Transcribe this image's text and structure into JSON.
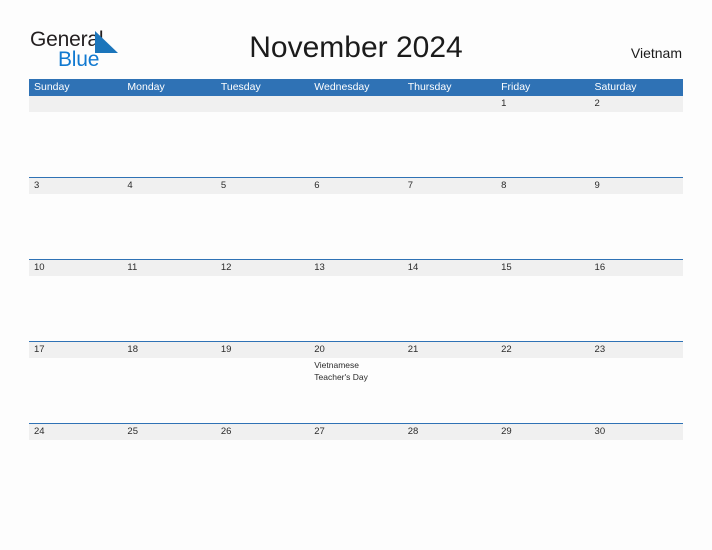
{
  "brand": {
    "name_top": "General",
    "name_bottom": "Blue",
    "flag_color": "#1b75bb",
    "blue_text_color": "#1179d0",
    "top_text_color": "#231f20"
  },
  "header": {
    "title": "November 2024",
    "country": "Vietnam"
  },
  "colors": {
    "header_blue": "#2f72b5",
    "date_band_gray": "#f0f0f0",
    "page_background": "#fdfdfd",
    "separator_blue": "#2f72b5"
  },
  "calendar": {
    "day_headers": [
      "Sunday",
      "Monday",
      "Tuesday",
      "Wednesday",
      "Thursday",
      "Friday",
      "Saturday"
    ],
    "weeks": [
      {
        "days": [
          {
            "date": "",
            "events": []
          },
          {
            "date": "",
            "events": []
          },
          {
            "date": "",
            "events": []
          },
          {
            "date": "",
            "events": []
          },
          {
            "date": "",
            "events": []
          },
          {
            "date": "1",
            "events": []
          },
          {
            "date": "2",
            "events": []
          }
        ]
      },
      {
        "days": [
          {
            "date": "3",
            "events": []
          },
          {
            "date": "4",
            "events": []
          },
          {
            "date": "5",
            "events": []
          },
          {
            "date": "6",
            "events": []
          },
          {
            "date": "7",
            "events": []
          },
          {
            "date": "8",
            "events": []
          },
          {
            "date": "9",
            "events": []
          }
        ]
      },
      {
        "days": [
          {
            "date": "10",
            "events": []
          },
          {
            "date": "11",
            "events": []
          },
          {
            "date": "12",
            "events": []
          },
          {
            "date": "13",
            "events": []
          },
          {
            "date": "14",
            "events": []
          },
          {
            "date": "15",
            "events": []
          },
          {
            "date": "16",
            "events": []
          }
        ]
      },
      {
        "days": [
          {
            "date": "17",
            "events": []
          },
          {
            "date": "18",
            "events": []
          },
          {
            "date": "19",
            "events": []
          },
          {
            "date": "20",
            "events": [
              "Vietnamese Teacher's Day"
            ]
          },
          {
            "date": "21",
            "events": []
          },
          {
            "date": "22",
            "events": []
          },
          {
            "date": "23",
            "events": []
          }
        ]
      },
      {
        "days": [
          {
            "date": "24",
            "events": []
          },
          {
            "date": "25",
            "events": []
          },
          {
            "date": "26",
            "events": []
          },
          {
            "date": "27",
            "events": []
          },
          {
            "date": "28",
            "events": []
          },
          {
            "date": "29",
            "events": []
          },
          {
            "date": "30",
            "events": []
          }
        ]
      }
    ]
  }
}
